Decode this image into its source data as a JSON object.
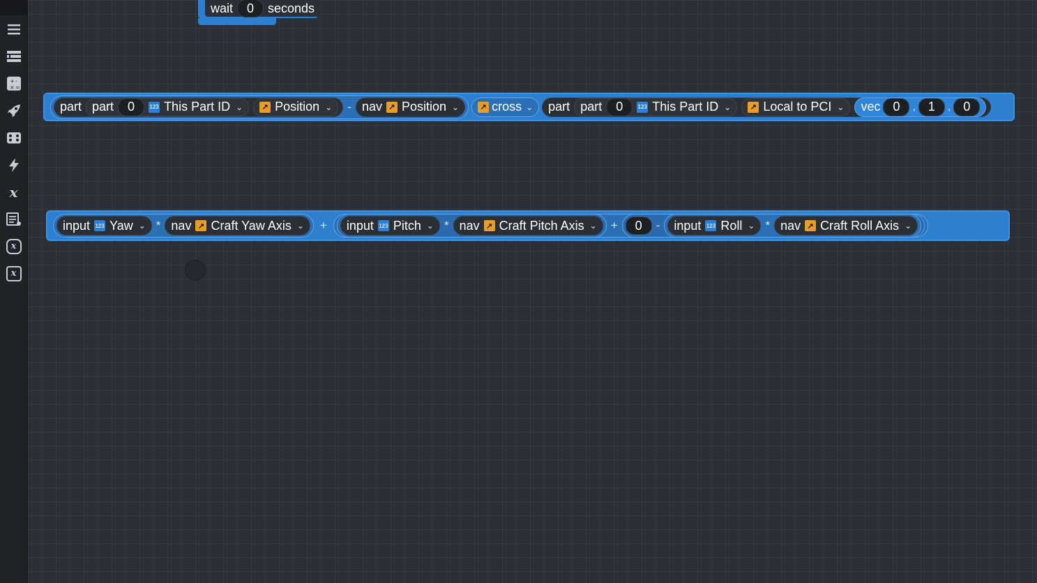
{
  "sidebar": {
    "buttons": [
      {
        "name": "menu-icon"
      },
      {
        "name": "blocks-icon"
      },
      {
        "name": "math-icon"
      },
      {
        "name": "rocket-icon"
      },
      {
        "name": "gamepad-icon"
      },
      {
        "name": "lightning-icon"
      },
      {
        "name": "variables-icon",
        "glyph": "x"
      },
      {
        "name": "list-icon"
      },
      {
        "name": "custom-expression-icon",
        "glyph": "x"
      },
      {
        "name": "custom-instruction-icon",
        "glyph": "x"
      }
    ]
  },
  "wait_block": {
    "label": "wait",
    "value": "0",
    "unit": "seconds"
  },
  "block1": {
    "part1": {
      "label": "part",
      "inner_label": "part",
      "index": "0",
      "id_dropdown": "This Part ID",
      "prop_dropdown": "Position"
    },
    "minus": "-",
    "nav": {
      "label": "nav",
      "dropdown": "Position"
    },
    "cross_dropdown": "cross",
    "part2": {
      "label": "part",
      "inner_label": "part",
      "index": "0",
      "id_dropdown": "This Part ID",
      "prop_dropdown": "Local to PCI"
    },
    "vec": {
      "label": "vec",
      "x": "0",
      "y": "1",
      "z": "0",
      "comma": ","
    }
  },
  "block2": {
    "yaw_input": {
      "label": "input",
      "dropdown": "Yaw"
    },
    "times1": "*",
    "yaw_nav": {
      "label": "nav",
      "dropdown": "Craft Yaw Axis"
    },
    "plus1": "+",
    "pitch_input": {
      "label": "input",
      "dropdown": "Pitch"
    },
    "times2": "*",
    "pitch_nav": {
      "label": "nav",
      "dropdown": "Craft Pitch Axis"
    },
    "plus2": "+",
    "zero": "0",
    "minus": "-",
    "roll_input": {
      "label": "input",
      "dropdown": "Roll"
    },
    "times3": "*",
    "roll_nav": {
      "label": "nav",
      "dropdown": "Craft Roll Axis"
    }
  },
  "icons": {
    "number_badge": "123",
    "vector_badge": "↗",
    "chevron": "⌄"
  },
  "colors": {
    "canvas": "#2b2f36",
    "block_blue": "#2e7fcf",
    "number_badge": "#2e7fd6",
    "vector_badge": "#e89c2c"
  }
}
